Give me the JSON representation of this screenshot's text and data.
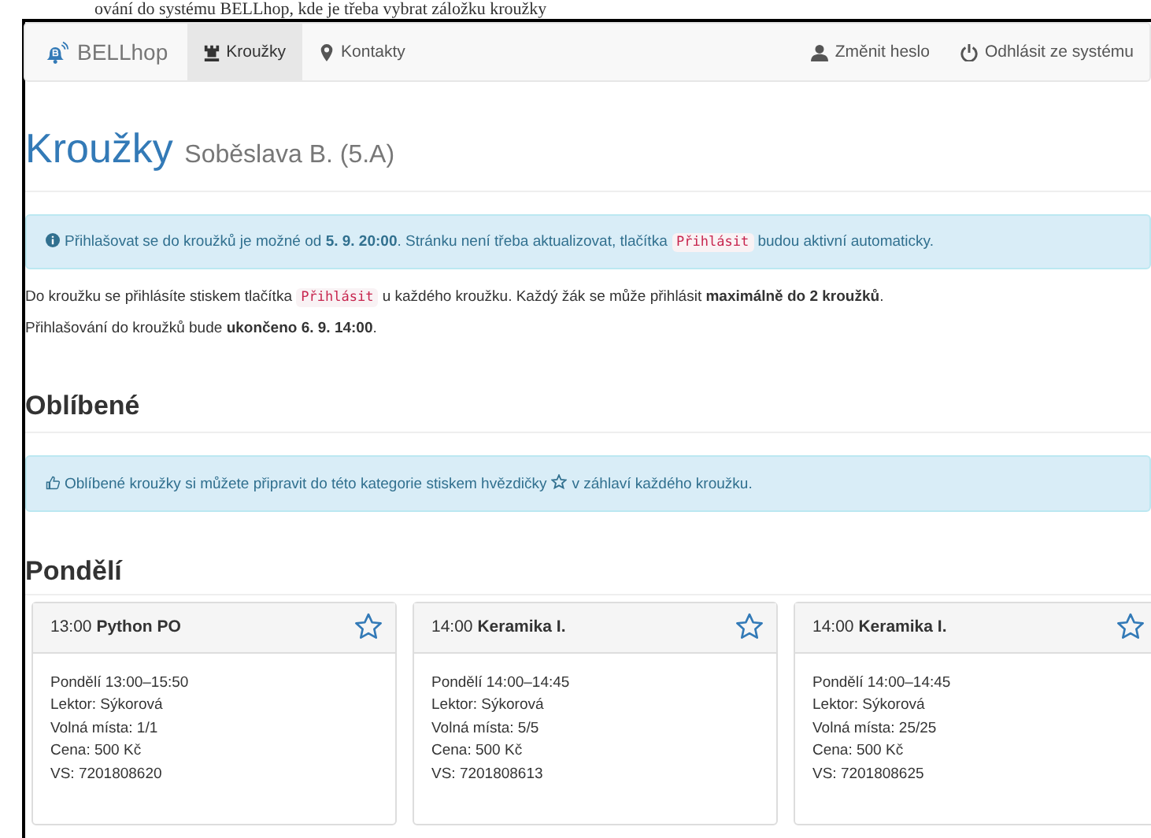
{
  "doc_caption": "ování do systému BELLhop, kde je třeba vybrat záložku kroužky",
  "navbar": {
    "brand": "BELLhop",
    "items": [
      {
        "label": "Kroužky",
        "kind": "rook",
        "selected": true
      },
      {
        "label": "Kontakty",
        "kind": "pin",
        "selected": false
      }
    ],
    "right_items": [
      {
        "label": "Změnit heslo",
        "kind": "user"
      },
      {
        "label": "Odhlásit ze systému",
        "kind": "power"
      }
    ]
  },
  "header": {
    "title": "Kroužky",
    "subtitle": "Soběslava B. (5.A)"
  },
  "notice": {
    "kind": "info",
    "segments": [
      {
        "kind": "plain",
        "text": "Přihlašovat se do kroužků je možné od "
      },
      {
        "kind": "bold",
        "text": "5. 9. 20:00"
      },
      {
        "kind": "plain",
        "text": ". Stránku není třeba aktualizovat, tlačítka "
      },
      {
        "kind": "code",
        "text": "Přihlásit"
      },
      {
        "kind": "plain",
        "text": " budou aktivní automaticky."
      }
    ]
  },
  "paragraphs": [
    [
      {
        "kind": "plain",
        "text": "Do kroužku se přihlásíte stiskem tlačítka "
      },
      {
        "kind": "code",
        "text": "Přihlásit"
      },
      {
        "kind": "plain",
        "text": " u každého kroužku. Každý žák se může přihlásit "
      },
      {
        "kind": "bold",
        "text": "maximálně do 2 kroužků"
      },
      {
        "kind": "plain",
        "text": "."
      }
    ],
    [
      {
        "kind": "plain",
        "text": "Přihlašování do kroužků bude "
      },
      {
        "kind": "bold",
        "text": "ukončeno 6. 9. 14:00"
      },
      {
        "kind": "plain",
        "text": "."
      }
    ]
  ],
  "favorites": {
    "heading": "Oblíbené",
    "notice": {
      "kind": "thumb",
      "segments": [
        {
          "kind": "plain",
          "text": "Oblíbené kroužky si můžete připravit do této kategorie stiskem hvězdičky"
        },
        {
          "kind": "star"
        },
        {
          "kind": "plain",
          "text": "v záhlaví každého kroužku."
        }
      ]
    }
  },
  "days": [
    {
      "heading": "Pondělí",
      "clubs": [
        {
          "time": "13:00",
          "name": "Python PO",
          "favorite": false,
          "lines": [
            "Pondělí 13:00–15:50",
            "Lektor: Sýkorová",
            "Volná místa: 1/1",
            "Cena: 500 Kč",
            "VS: 7201808620"
          ]
        },
        {
          "time": "14:00",
          "name": "Keramika I.",
          "favorite": false,
          "lines": [
            "Pondělí 14:00–14:45",
            "Lektor: Sýkorová",
            "Volná místa: 5/5",
            "Cena: 500 Kč",
            "VS: 7201808613"
          ]
        },
        {
          "time": "14:00",
          "name": "Keramika I.",
          "favorite": false,
          "lines": [
            "Pondělí 14:00–14:45",
            "Lektor: Sýkorová",
            "Volná místa: 25/25",
            "Cena: 500 Kč",
            "VS: 7201808625"
          ]
        }
      ]
    }
  ]
}
